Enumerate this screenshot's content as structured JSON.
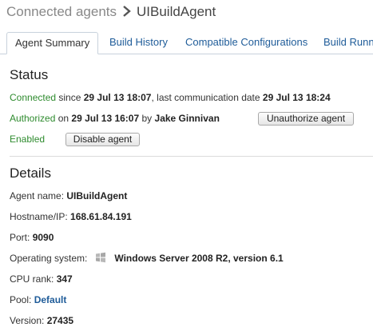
{
  "breadcrumb": {
    "parent": "Connected agents",
    "current": "UIBuildAgent"
  },
  "tabs": [
    {
      "label": "Agent Summary"
    },
    {
      "label": "Build History"
    },
    {
      "label": "Compatible Configurations"
    },
    {
      "label": "Build Runn"
    }
  ],
  "status": {
    "heading": "Status",
    "connected": {
      "state": "Connected",
      "since_label": "since",
      "since": "29 Jul 13 18:07",
      "last_label": ", last communication date",
      "last": "29 Jul 13 18:24"
    },
    "authorized": {
      "state": "Authorized",
      "on_label": "on",
      "date": "29 Jul 13 16:07",
      "by_label": "by",
      "user": "Jake Ginnivan",
      "button": "Unauthorize agent"
    },
    "enabled": {
      "state": "Enabled",
      "button": "Disable agent"
    }
  },
  "details": {
    "heading": "Details",
    "agent_name": {
      "label": "Agent name:",
      "value": "UIBuildAgent"
    },
    "hostname": {
      "label": "Hostname/IP:",
      "value": "168.61.84.191"
    },
    "port": {
      "label": "Port:",
      "value": "9090"
    },
    "os": {
      "label": "Operating system:",
      "icon": "windows-icon",
      "value": "Windows Server 2008 R2, version 6.1"
    },
    "cpu": {
      "label": "CPU rank:",
      "value": "347"
    },
    "pool": {
      "label": "Pool:",
      "value": "Default"
    },
    "version": {
      "label": "Version:",
      "value": "27435"
    }
  },
  "colors": {
    "link": "#1f5c99",
    "status_green": "#2e8b2e",
    "tab_border": "#c8d2dc"
  }
}
